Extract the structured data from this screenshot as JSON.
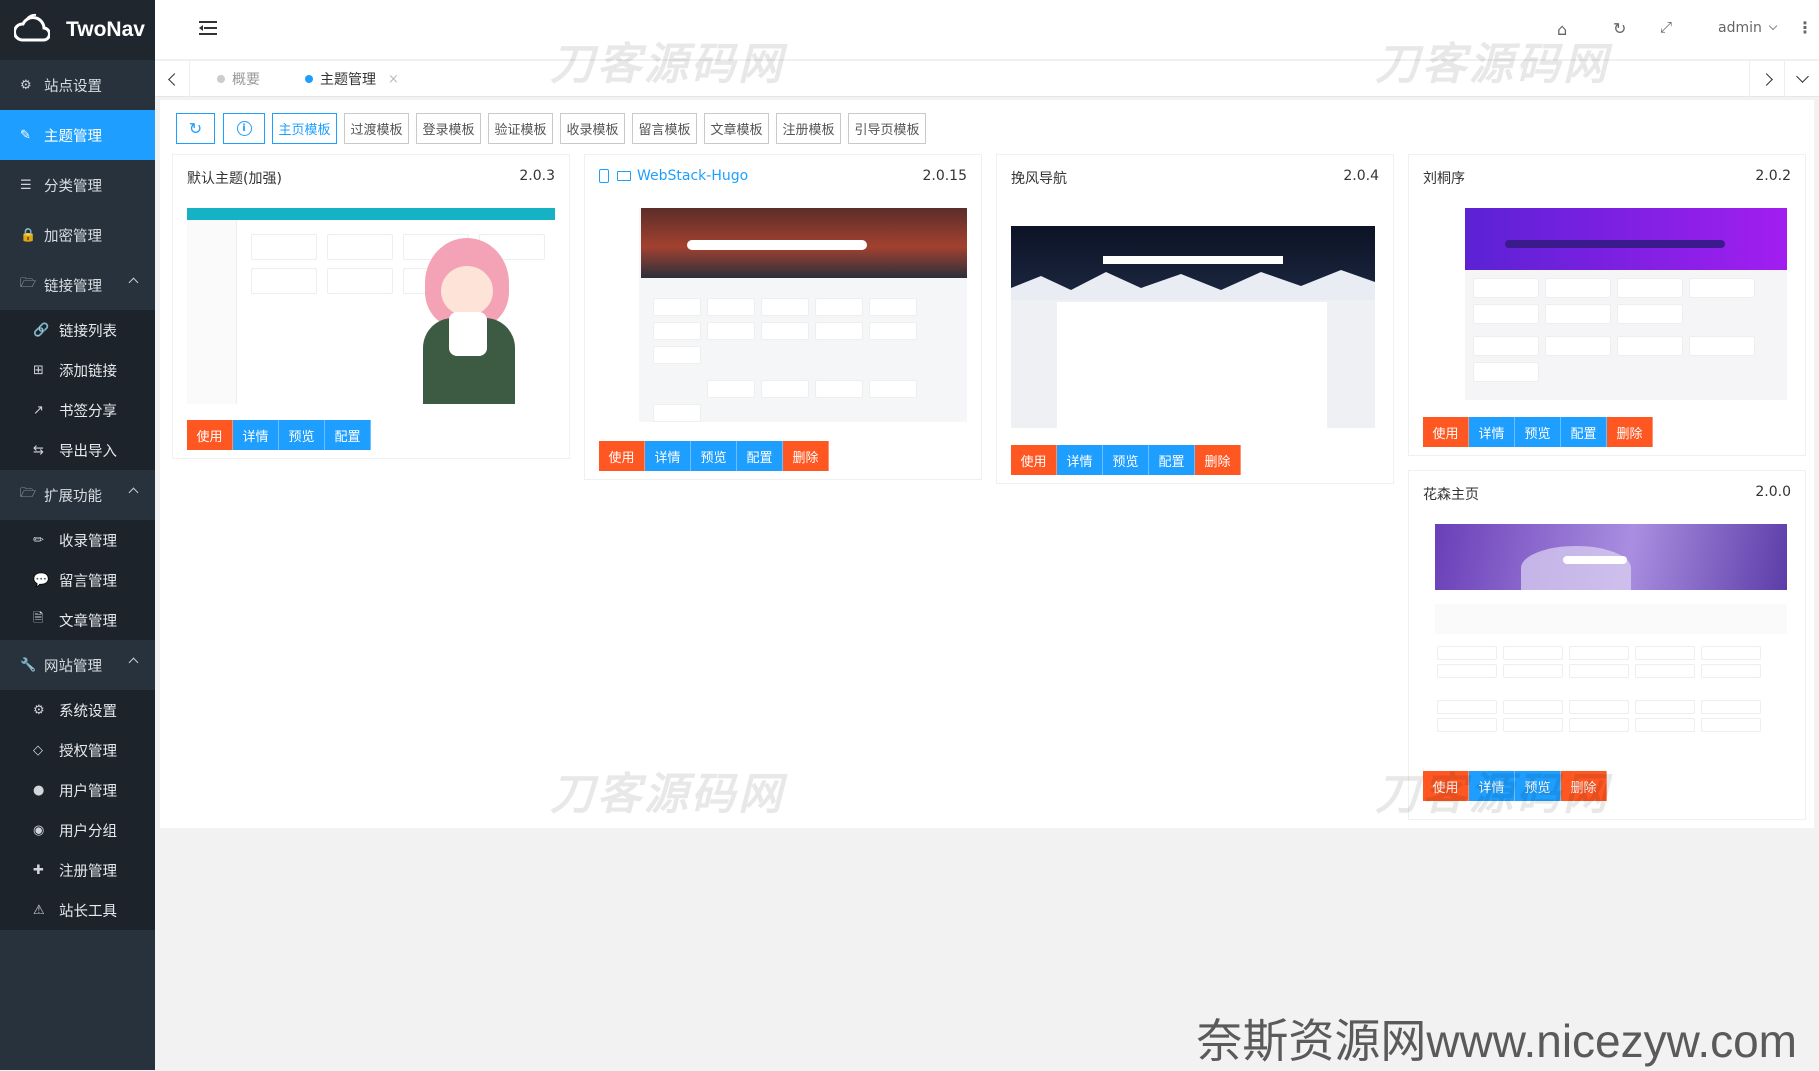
{
  "app": {
    "title": "TwoNav",
    "user": "admin"
  },
  "sidebar": {
    "items": [
      {
        "label": "站点设置",
        "icon": "gear-icon",
        "level": 1
      },
      {
        "label": "主题管理",
        "icon": "brush-icon",
        "level": 1,
        "active": true
      },
      {
        "label": "分类管理",
        "icon": "list-icon",
        "level": 1
      },
      {
        "label": "加密管理",
        "icon": "lock-icon",
        "level": 1
      },
      {
        "label": "链接管理",
        "icon": "folder-open-icon",
        "level": 1,
        "expanded": true
      },
      {
        "label": "链接列表",
        "icon": "link-icon",
        "level": 2
      },
      {
        "label": "添加链接",
        "icon": "plus-square-icon",
        "level": 2
      },
      {
        "label": "书签分享",
        "icon": "share-icon",
        "level": 2
      },
      {
        "label": "导出导入",
        "icon": "exchange-icon",
        "level": 2
      },
      {
        "label": "扩展功能",
        "icon": "folder-open-icon",
        "level": 1,
        "expanded": true
      },
      {
        "label": "收录管理",
        "icon": "pencil-icon",
        "level": 2
      },
      {
        "label": "留言管理",
        "icon": "comment-icon",
        "level": 2
      },
      {
        "label": "文章管理",
        "icon": "article-icon",
        "level": 2
      },
      {
        "label": "网站管理",
        "icon": "wrench-icon",
        "level": 1,
        "expanded": true
      },
      {
        "label": "系统设置",
        "icon": "cogs-icon",
        "level": 2
      },
      {
        "label": "授权管理",
        "icon": "diamond-icon",
        "level": 2
      },
      {
        "label": "用户管理",
        "icon": "user-icon",
        "level": 2
      },
      {
        "label": "用户分组",
        "icon": "users-icon",
        "level": 2
      },
      {
        "label": "注册管理",
        "icon": "user-plus-icon",
        "level": 2
      },
      {
        "label": "站长工具",
        "icon": "warning-icon",
        "level": 2
      }
    ]
  },
  "tabs": [
    {
      "label": "概要",
      "active": false
    },
    {
      "label": "主题管理",
      "active": true
    }
  ],
  "toolbar": {
    "template_buttons": [
      "主页模板",
      "过渡模板",
      "登录模板",
      "验证模板",
      "收录模板",
      "留言模板",
      "文章模板",
      "注册模板",
      "引导页模板"
    ]
  },
  "themes": [
    {
      "name": "默认主题(加强)",
      "version": "2.0.3",
      "actions": [
        "使用",
        "详情",
        "预览",
        "配置"
      ]
    },
    {
      "name": "WebStack-Hugo",
      "version": "2.0.15",
      "actions": [
        "使用",
        "详情",
        "预览",
        "配置",
        "删除"
      ]
    },
    {
      "name": "挽风导航",
      "version": "2.0.4",
      "actions": [
        "使用",
        "详情",
        "预览",
        "配置",
        "删除"
      ]
    },
    {
      "name": "刘桐序",
      "version": "2.0.2",
      "actions": [
        "使用",
        "详情",
        "预览",
        "配置",
        "删除"
      ]
    },
    {
      "name": "花森主页",
      "version": "2.0.0",
      "actions": [
        "使用",
        "详情",
        "预览",
        "删除"
      ]
    }
  ],
  "watermarks": [
    "刀客源码网",
    "刀客源码网",
    "刀客源码网",
    "刀客源码网"
  ],
  "bottom_watermark": "奈斯资源网www.nicezyw.com",
  "colors": {
    "accent": "#1e9fff",
    "danger": "#ff5722",
    "sidebar": "#28323d"
  }
}
